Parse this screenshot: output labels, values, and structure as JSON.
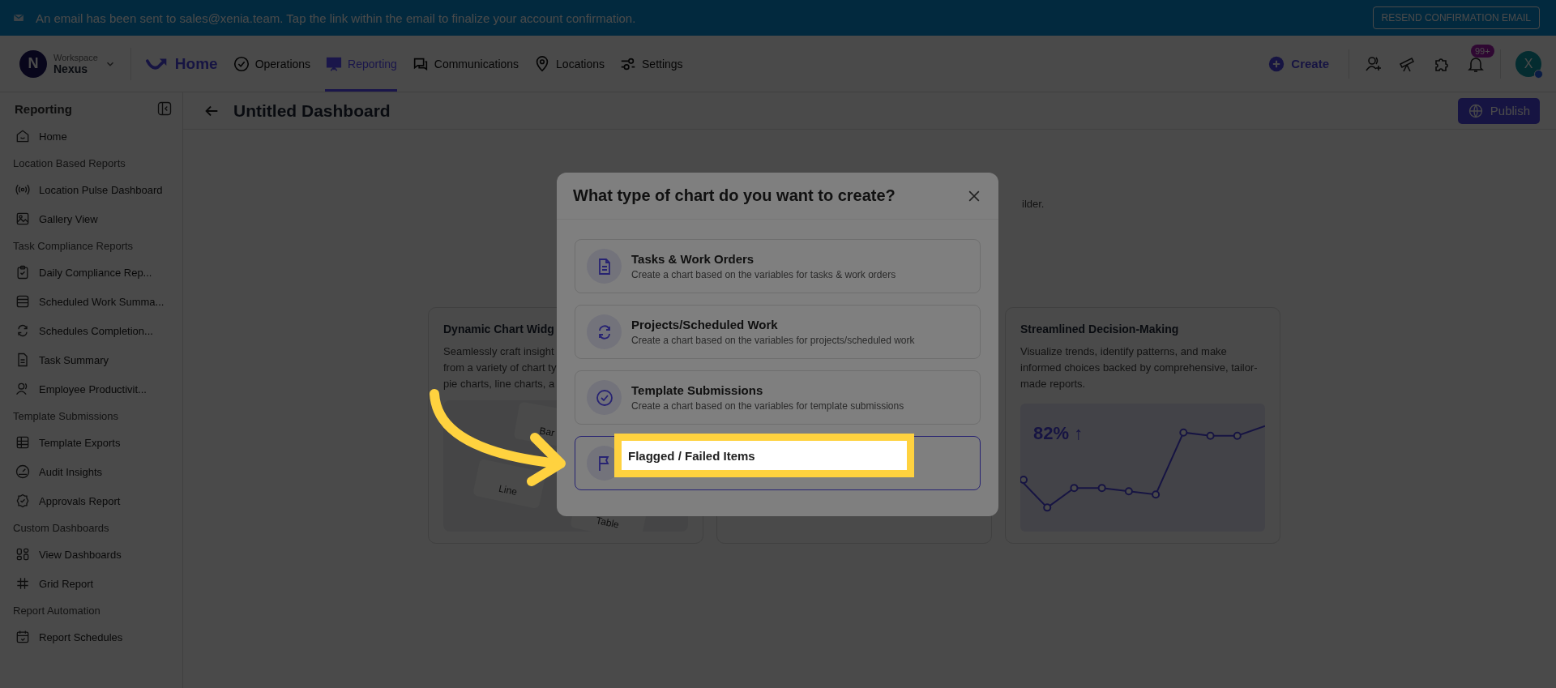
{
  "banner": {
    "message": "An email has been sent to sales@xenia.team. Tap the link within the email to finalize your account confirmation.",
    "button": "RESEND CONFIRMATION EMAIL"
  },
  "workspace": {
    "initial": "N",
    "label": "Workspace",
    "name": "Nexus"
  },
  "nav": [
    {
      "label": "Home",
      "kind": "brand"
    },
    {
      "label": "Operations",
      "kind": "tab",
      "selected": false
    },
    {
      "label": "Reporting",
      "kind": "tab",
      "selected": true
    },
    {
      "label": "Communications",
      "kind": "tab",
      "selected": false
    },
    {
      "label": "Locations",
      "kind": "tab",
      "selected": false
    },
    {
      "label": "Settings",
      "kind": "tab",
      "selected": false
    }
  ],
  "create": "Create",
  "notifications": "99+",
  "avatar": "X",
  "sidebar": {
    "title": "Reporting",
    "items": [
      {
        "kind": "item",
        "label": "Home"
      },
      {
        "kind": "header",
        "label": "Location Based Reports"
      },
      {
        "kind": "item",
        "label": "Location Pulse Dashboard"
      },
      {
        "kind": "item",
        "label": "Gallery View"
      },
      {
        "kind": "header",
        "label": "Task Compliance Reports"
      },
      {
        "kind": "item",
        "label": "Daily Compliance Rep..."
      },
      {
        "kind": "item",
        "label": "Scheduled Work Summa..."
      },
      {
        "kind": "item",
        "label": "Schedules Completion..."
      },
      {
        "kind": "item",
        "label": "Task Summary"
      },
      {
        "kind": "item",
        "label": "Employee Productivit..."
      },
      {
        "kind": "header",
        "label": "Template Submissions"
      },
      {
        "kind": "item",
        "label": "Template Exports"
      },
      {
        "kind": "item",
        "label": "Audit Insights"
      },
      {
        "kind": "item",
        "label": "Approvals Report"
      },
      {
        "kind": "header",
        "label": "Custom Dashboards"
      },
      {
        "kind": "item",
        "label": "View Dashboards"
      },
      {
        "kind": "item",
        "label": "Grid Report"
      },
      {
        "kind": "header",
        "label": "Report Automation"
      },
      {
        "kind": "item",
        "label": "Report Schedules"
      }
    ]
  },
  "page": {
    "title": "Untitled Dashboard",
    "publish": "Publish",
    "subtitle_fragment": "ilder."
  },
  "cards": [
    {
      "kind": "widgets",
      "title": "Dynamic Chart Widg",
      "lines": [
        "Seamlessly craft insight",
        "from a variety of chart ty",
        "pie charts, line charts, a"
      ],
      "widget_labels": [
        "Bar",
        "Line",
        "Table"
      ]
    },
    {
      "kind": "hidden"
    },
    {
      "kind": "trend",
      "title": "Streamlined Decision-Making",
      "lines": [
        "Visualize trends, identify patterns, and make",
        "informed choices backed by comprehensive, tailor-",
        "made reports."
      ],
      "stat": "82% ↑"
    }
  ],
  "modal": {
    "title": "What type of chart do you want to create?",
    "options": [
      {
        "title": "Tasks & Work Orders",
        "description": "Create a chart based on the variables for tasks & work orders",
        "selected": false,
        "highlighted": false
      },
      {
        "title": "Projects/Scheduled Work",
        "description": "Create a chart based on the variables for projects/scheduled work",
        "selected": false,
        "highlighted": false
      },
      {
        "title": "Template Submissions",
        "description": "Create a chart based on the variables for template submissions",
        "selected": false,
        "highlighted": false
      },
      {
        "title": "Flagged / Failed Items",
        "selected": true,
        "highlighted": true
      }
    ]
  }
}
